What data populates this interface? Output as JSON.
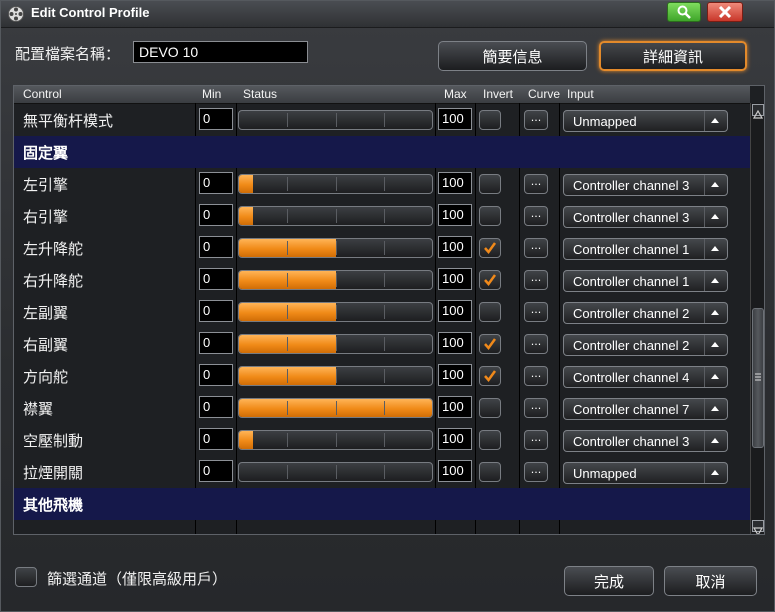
{
  "window": {
    "title": "Edit Control Profile"
  },
  "profile": {
    "name_label": "配置檔案名稱：",
    "name_value": "DEVO 10"
  },
  "buttons": {
    "summary": "簡要信息",
    "detail": "詳細資訊",
    "done": "完成",
    "cancel": "取消"
  },
  "table": {
    "headers": {
      "control": "Control",
      "min": "Min",
      "status": "Status",
      "max": "Max",
      "invert": "Invert",
      "curve": "Curve",
      "input": "Input"
    },
    "curve_label": "...",
    "rows": [
      {
        "type": "control",
        "label": "無平衡杆模式",
        "min": "0",
        "max": "100",
        "status": 0,
        "invert": false,
        "input": "Unmapped"
      },
      {
        "type": "section",
        "label": "固定翼"
      },
      {
        "type": "control",
        "label": "左引擎",
        "min": "0",
        "max": "100",
        "status": 0.07,
        "invert": false,
        "input": "Controller channel 3"
      },
      {
        "type": "control",
        "label": "右引擎",
        "min": "0",
        "max": "100",
        "status": 0.07,
        "invert": false,
        "input": "Controller channel 3"
      },
      {
        "type": "control",
        "label": "左升降舵",
        "min": "0",
        "max": "100",
        "status": 0.5,
        "invert": true,
        "input": "Controller channel 1"
      },
      {
        "type": "control",
        "label": "右升降舵",
        "min": "0",
        "max": "100",
        "status": 0.5,
        "invert": true,
        "input": "Controller channel 1"
      },
      {
        "type": "control",
        "label": "左副翼",
        "min": "0",
        "max": "100",
        "status": 0.5,
        "invert": false,
        "input": "Controller channel 2"
      },
      {
        "type": "control",
        "label": "右副翼",
        "min": "0",
        "max": "100",
        "status": 0.5,
        "invert": true,
        "input": "Controller channel 2"
      },
      {
        "type": "control",
        "label": "方向舵",
        "min": "0",
        "max": "100",
        "status": 0.5,
        "invert": true,
        "input": "Controller channel 4"
      },
      {
        "type": "control",
        "label": "襟翼",
        "min": "0",
        "max": "100",
        "status": 1.0,
        "invert": false,
        "input": "Controller channel 7"
      },
      {
        "type": "control",
        "label": "空壓制動",
        "min": "0",
        "max": "100",
        "status": 0.07,
        "invert": false,
        "input": "Controller channel 3"
      },
      {
        "type": "control",
        "label": "拉煙開關",
        "min": "0",
        "max": "100",
        "status": 0,
        "invert": false,
        "input": "Unmapped"
      },
      {
        "type": "section",
        "label": "其他飛機"
      }
    ]
  },
  "filter": {
    "label": "篩選通道（僅限高級用戶）",
    "checked": false
  },
  "colors": {
    "accent": "#e38a2b",
    "section_bg": "#15184a",
    "bar_fill": "#f08a17"
  }
}
